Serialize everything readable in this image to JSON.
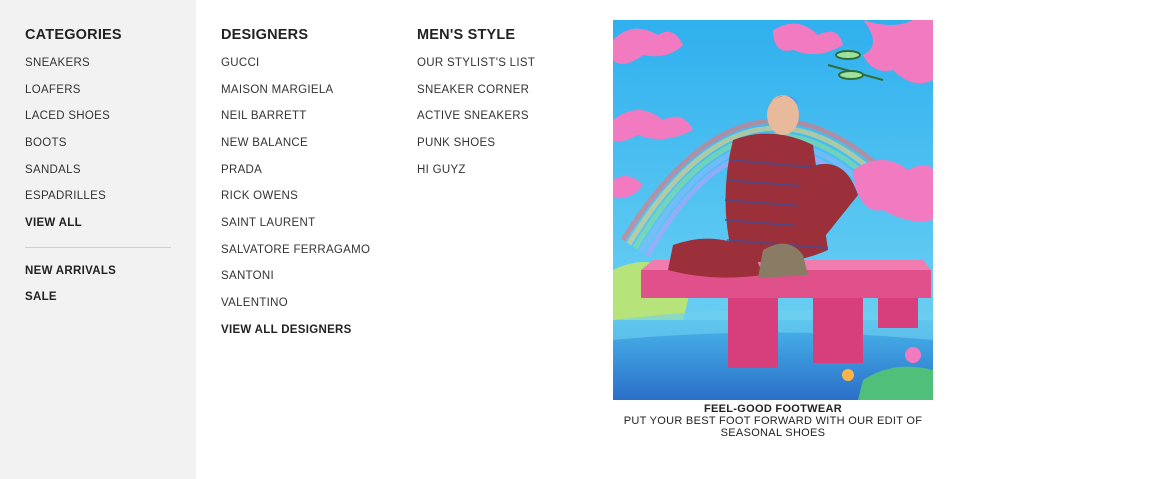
{
  "categories": {
    "title": "CATEGORIES",
    "items": [
      "SNEAKERS",
      "LOAFERS",
      "LACED SHOES",
      "BOOTS",
      "SANDALS",
      "ESPADRILLES"
    ],
    "view_all": "VIEW ALL",
    "extra": [
      "NEW ARRIVALS",
      "SALE"
    ]
  },
  "designers": {
    "title": "DESIGNERS",
    "items": [
      "GUCCI",
      "MAISON MARGIELA",
      "NEIL BARRETT",
      "NEW BALANCE",
      "PRADA",
      "RICK OWENS",
      "SAINT LAURENT",
      "SALVATORE FERRAGAMO",
      "SANTONI",
      "VALENTINO"
    ],
    "view_all": "VIEW ALL DESIGNERS"
  },
  "mens_style": {
    "title": "MEN'S STYLE",
    "items": [
      "OUR STYLIST'S LIST",
      "SNEAKER CORNER",
      "ACTIVE SNEAKERS",
      "PUNK SHOES",
      "HI GUYZ"
    ]
  },
  "promo": {
    "title": "FEEL-GOOD FOOTWEAR",
    "subtitle_line1": "PUT YOUR BEST FOOT FORWARD WITH OUR EDIT OF",
    "subtitle_line2": "SEASONAL SHOES"
  },
  "colors": {
    "sidebar_bg": "#f2f2f2",
    "text": "#222222",
    "sky": "#35b5f0",
    "cloud_pink": "#f27ac0",
    "bench_pink": "#e0508a",
    "water": "#2f8fd8"
  }
}
